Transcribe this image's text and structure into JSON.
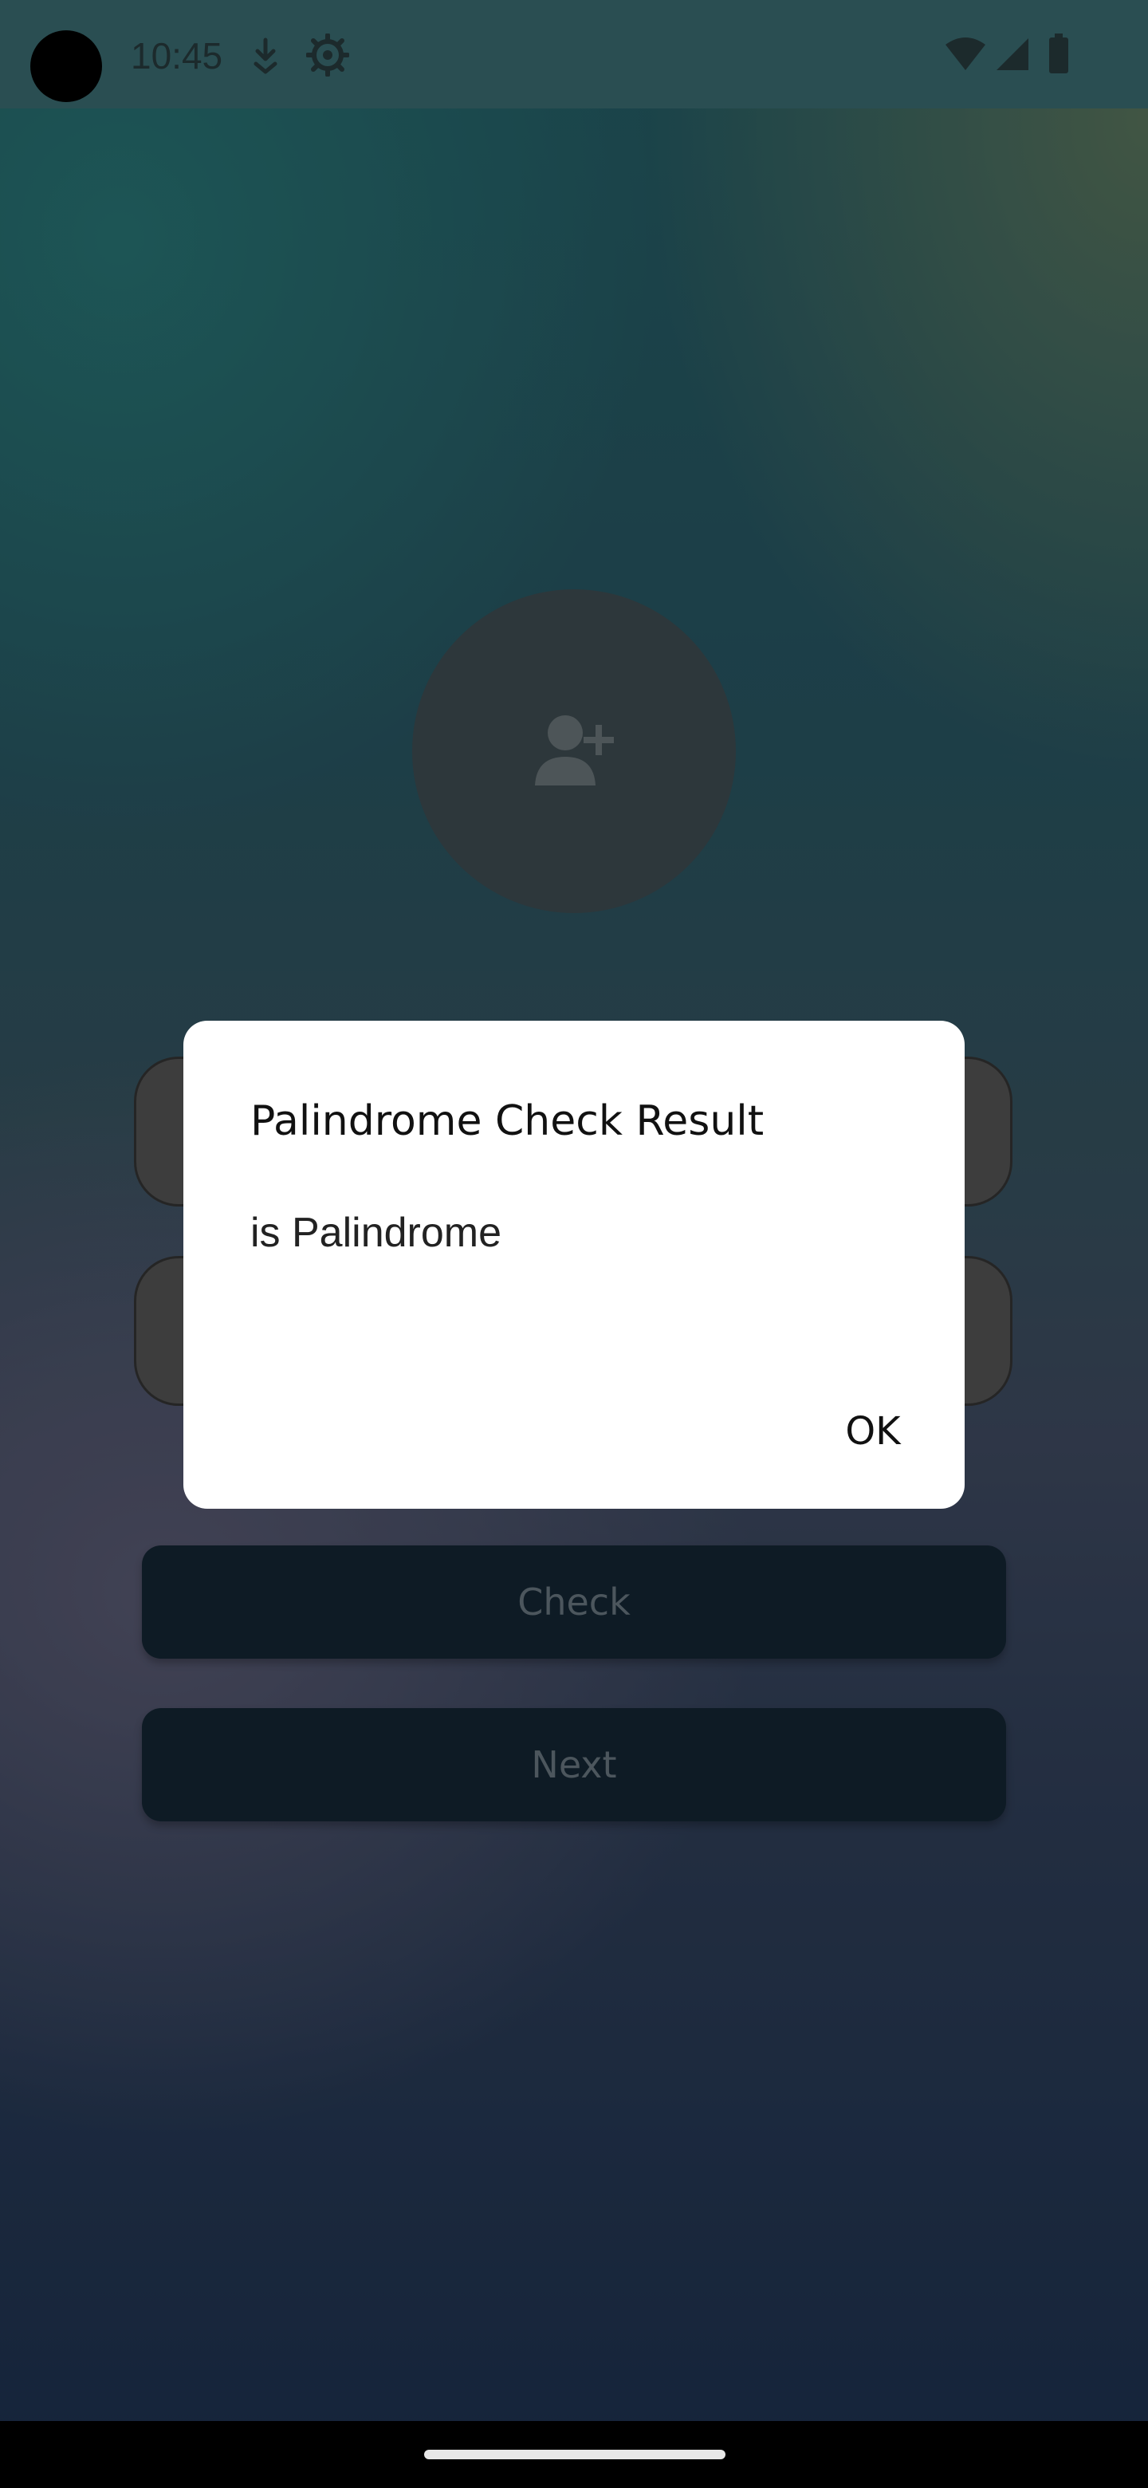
{
  "status_bar": {
    "time": "10:45",
    "icons": [
      "download-icon",
      "settings-icon",
      "wifi-icon",
      "signal-icon",
      "battery-icon"
    ]
  },
  "profile": {
    "icon": "add-person-icon"
  },
  "form": {
    "check_label": "Check",
    "next_label": "Next"
  },
  "dialog": {
    "title": "Palindrome Check Result",
    "message": "is Palindrome",
    "ok_label": "OK"
  },
  "colors": {
    "button_bg": "#172c3c",
    "dialog_bg": "#ffffff"
  }
}
